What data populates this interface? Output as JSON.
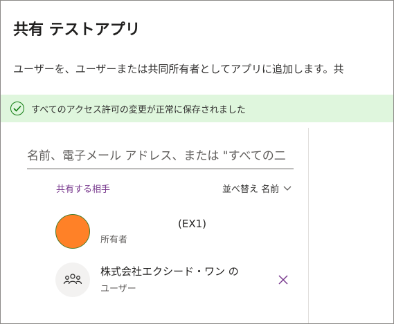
{
  "dialog": {
    "title": "共有 テストアプリ",
    "description": "ユーザーを、ユーザーまたは共同所有者としてアプリに追加します。共"
  },
  "banner": {
    "icon": "check-circle-icon",
    "message": "すべてのアクセス許可の変更が正常に保存されました",
    "color": "#dff6dd"
  },
  "search": {
    "value": "",
    "placeholder": "名前、電子メール アドレス、または \"すべての二"
  },
  "list": {
    "header_label": "共有する相手",
    "sort_label": "並べ替え 名前",
    "sort_icon": "chevron-down-icon",
    "people": [
      {
        "name": "(EX1)",
        "role": "所有者",
        "avatar_color": "#ff8127"
      },
      {
        "name": "株式会社エクシード・ワン の",
        "role": "ユーザー",
        "icon": "group-icon",
        "action_icon": "close-icon"
      }
    ]
  },
  "colors": {
    "accent": "#7a3b8f",
    "success": "#107c10"
  }
}
